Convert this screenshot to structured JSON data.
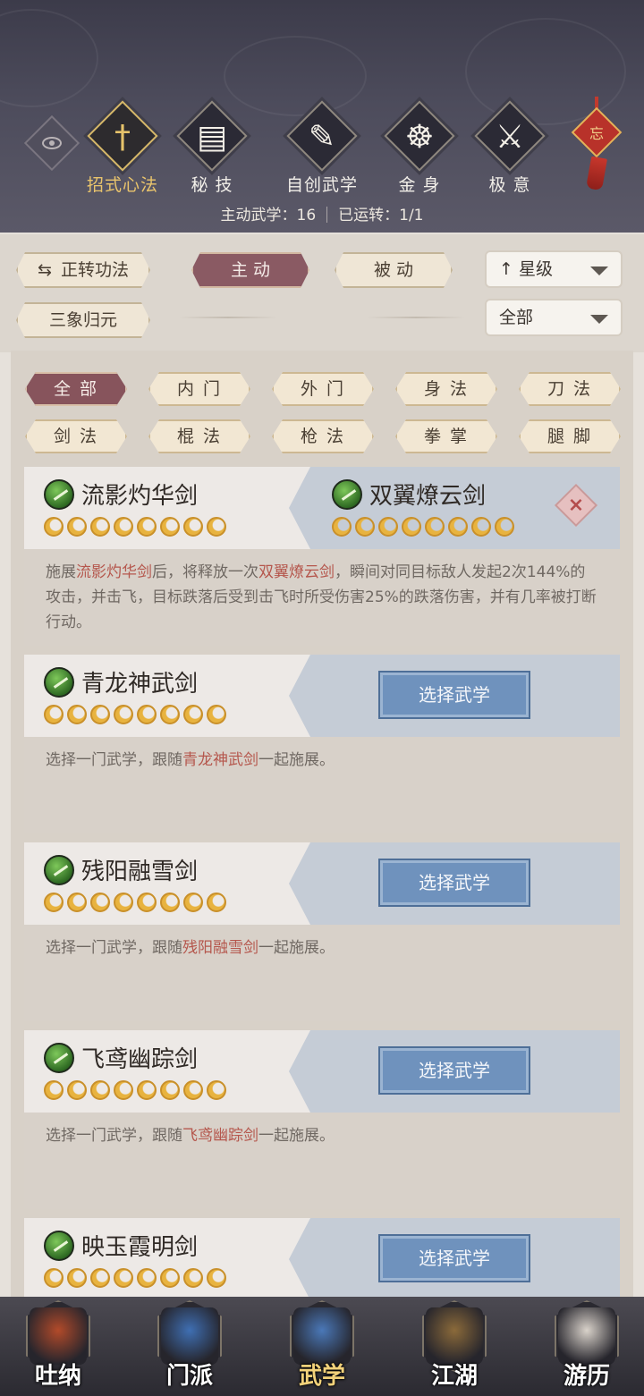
{
  "header": {
    "tabs": [
      {
        "label": "招式心法",
        "icon": "sword-icon",
        "glyph": "†",
        "active": true
      },
      {
        "label": "秘 技",
        "icon": "book-icon",
        "glyph": "▤",
        "active": false
      },
      {
        "label": "自创武学",
        "icon": "scroll-brush-icon",
        "glyph": "✎",
        "active": false
      },
      {
        "label": "金 身",
        "icon": "meditation-icon",
        "glyph": "☸",
        "active": false
      },
      {
        "label": "极 意",
        "icon": "martial-stance-icon",
        "glyph": "⚔",
        "active": false
      }
    ],
    "knot_char": "忘",
    "stats": {
      "active_label": "主动武学：",
      "active_value": "16",
      "running_label": "已运转：",
      "running_value": "1/1"
    }
  },
  "filters": {
    "switch_label": "正转功法",
    "active_label": "主 动",
    "passive_label": "被 动",
    "sanxiang_label": "三象归元",
    "sort_label": "星级",
    "sort_arrow": "↑",
    "scope_label": "全部"
  },
  "categories": [
    "全 部",
    "内 门",
    "外 门",
    "身 法",
    "刀 法",
    "剑 法",
    "棍 法",
    "枪 法",
    "拳 掌",
    "腿 脚"
  ],
  "cards": [
    {
      "left_skill": "流影灼华剑",
      "right_skill": "双翼燎云剑",
      "stars": 8,
      "desc_parts": [
        {
          "t": "施展",
          "hl": false
        },
        {
          "t": "流影灼华剑",
          "hl": true
        },
        {
          "t": "后，将释放一次",
          "hl": false
        },
        {
          "t": "双翼燎云剑",
          "hl": true
        },
        {
          "t": "，瞬间对同目标敌人发起2次144%的攻击，并击飞，目标跌落后受到击飞时所受伤害25%的跌落伤害，并有几率被打断行动。",
          "hl": false
        }
      ]
    },
    {
      "left_skill": "青龙神武剑",
      "button": "选择武学",
      "stars": 8,
      "desc_parts": [
        {
          "t": "选择一门武学，跟随",
          "hl": false
        },
        {
          "t": "青龙神武剑",
          "hl": true
        },
        {
          "t": "一起施展。",
          "hl": false
        }
      ]
    },
    {
      "left_skill": "残阳融雪剑",
      "button": "选择武学",
      "stars": 8,
      "desc_parts": [
        {
          "t": "选择一门武学，跟随",
          "hl": false
        },
        {
          "t": "残阳融雪剑",
          "hl": true
        },
        {
          "t": "一起施展。",
          "hl": false
        }
      ]
    },
    {
      "left_skill": "飞鸢幽踪剑",
      "button": "选择武学",
      "stars": 8,
      "desc_parts": [
        {
          "t": "选择一门武学，跟随",
          "hl": false
        },
        {
          "t": "飞鸢幽踪剑",
          "hl": true
        },
        {
          "t": "一起施展。",
          "hl": false
        }
      ]
    },
    {
      "left_skill": "映玉霞明剑",
      "button": "选择武学",
      "stars": 8,
      "desc_parts": []
    }
  ],
  "bottom_nav": [
    {
      "label": "吐纳",
      "icon": "monk-icon",
      "color": "#b24a2a",
      "active": false
    },
    {
      "label": "门派",
      "icon": "banner-icon",
      "color": "#3f6fb3",
      "active": false
    },
    {
      "label": "武学",
      "icon": "manual-book-icon",
      "color": "#4a78b8",
      "active": true
    },
    {
      "label": "江湖",
      "icon": "straw-hat-icon",
      "color": "#8b6a3a",
      "active": false
    },
    {
      "label": "游历",
      "icon": "horse-icon",
      "color": "#d9d2ca",
      "active": false
    }
  ],
  "colors": {
    "accent_gold": "#e9c46c",
    "highlight_red": "#b5574d",
    "button_blue": "#6f92bd",
    "active_pill": "#87545c"
  }
}
